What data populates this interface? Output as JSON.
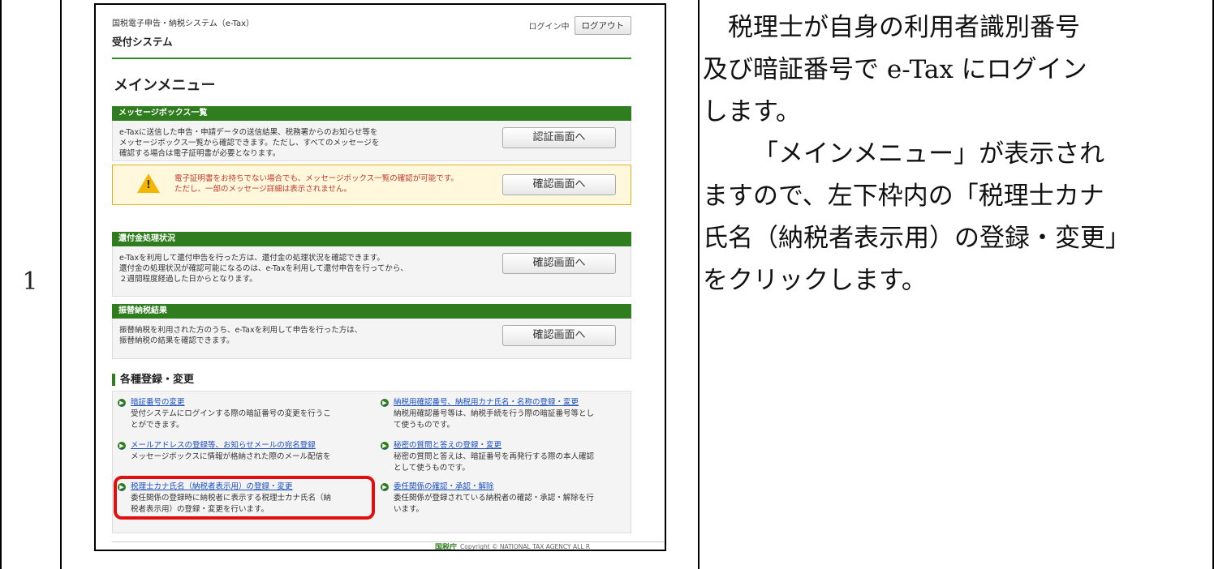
{
  "row_number": "1",
  "instruction": {
    "line1": "税理士が自身の利用者識別番号",
    "line2": "及び暗証番号で e-Tax にログイン",
    "line3": "します。",
    "line4": "「メインメニュー」が表示され",
    "line5": "ますので、左下枠内の「税理士カナ",
    "line6": "氏名（納税者表示用）の登録・変更」",
    "line7": "をクリックします。"
  },
  "screen": {
    "system_name": "国税電子申告・納税システム（e-Tax）",
    "subsystem": "受付システム",
    "login_status": "ログイン中",
    "logout_label": "ログアウト",
    "menu_title": "メインメニュー",
    "sections": {
      "message_box": {
        "title": "メッセージボックス一覧",
        "text1": "e-Taxに送信した申告・申請データの送信結果、税務署からのお知らせ等を",
        "text2": "メッセージボックス一覧から確認できます。ただし、すべてのメッセージを",
        "text3": "確認する場合は電子証明書が必要となります。",
        "button": "認証画面へ",
        "warn1": "電子証明書をお持ちでない場合でも、メッセージボックス一覧の確認が可能です。",
        "warn2": "ただし、一部のメッセージ詳細は表示されません。",
        "warn_button": "確認画面へ"
      },
      "refund": {
        "title": "還付金処理状況",
        "text1": "e-Taxを利用して還付申告を行った方は、還付金の処理状況を確認できます。",
        "text2": "還付金の処理状況が確認可能になるのは、e-Taxを利用して還付申告を行ってから、",
        "text3": "２週間程度経過した日からとなります。",
        "button": "確認画面へ"
      },
      "transfer": {
        "title": "振替納税結果",
        "text1": "振替納税を利用された方のうち、e-Taxを利用して申告を行った方は、",
        "text2": "振替納税の結果を確認できます。",
        "button": "確認画面へ"
      }
    },
    "registration": {
      "heading": "各種登録・変更",
      "items": [
        {
          "link": "暗証番号の変更",
          "desc1": "受付システムにログインする際の暗証番号の変更を行うこ",
          "desc2": "とができます。"
        },
        {
          "link": "納税用確認番号、納税用カナ氏名・名称の登録・変更",
          "desc1": "納税用確認番号等は、納税手続を行う際の暗証番号等とし",
          "desc2": "て使うものです。"
        },
        {
          "link": "メールアドレスの登録等、お知らせメールの宛名登録",
          "desc1": "メッセージボックスに情報が格納された際のメール配信を",
          "desc2": ""
        },
        {
          "link": "秘密の質問と答えの登録・変更",
          "desc1": "秘密の質問と答えは、暗証番号を再発行する際の本人確認",
          "desc2": "として使うものです。"
        },
        {
          "link": "税理士カナ氏名（納税者表示用）の登録・変更",
          "desc1": "委任関係の登録時に納税者に表示する税理士カナ氏名（納",
          "desc2": "税者表示用）の登録・変更を行います。"
        },
        {
          "link": "委任関係の確認・承認・解除",
          "desc1": "委任関係が登録されている納税者の確認・承認・解除を行",
          "desc2": "います。"
        }
      ]
    },
    "footer": {
      "logo": "国税庁",
      "copyright": "Copyright © NATIONAL TAX AGENCY ALL R"
    }
  },
  "colors": {
    "green": "#2f7d1e",
    "highlight": "#e01010",
    "link": "#1a4fbf"
  }
}
